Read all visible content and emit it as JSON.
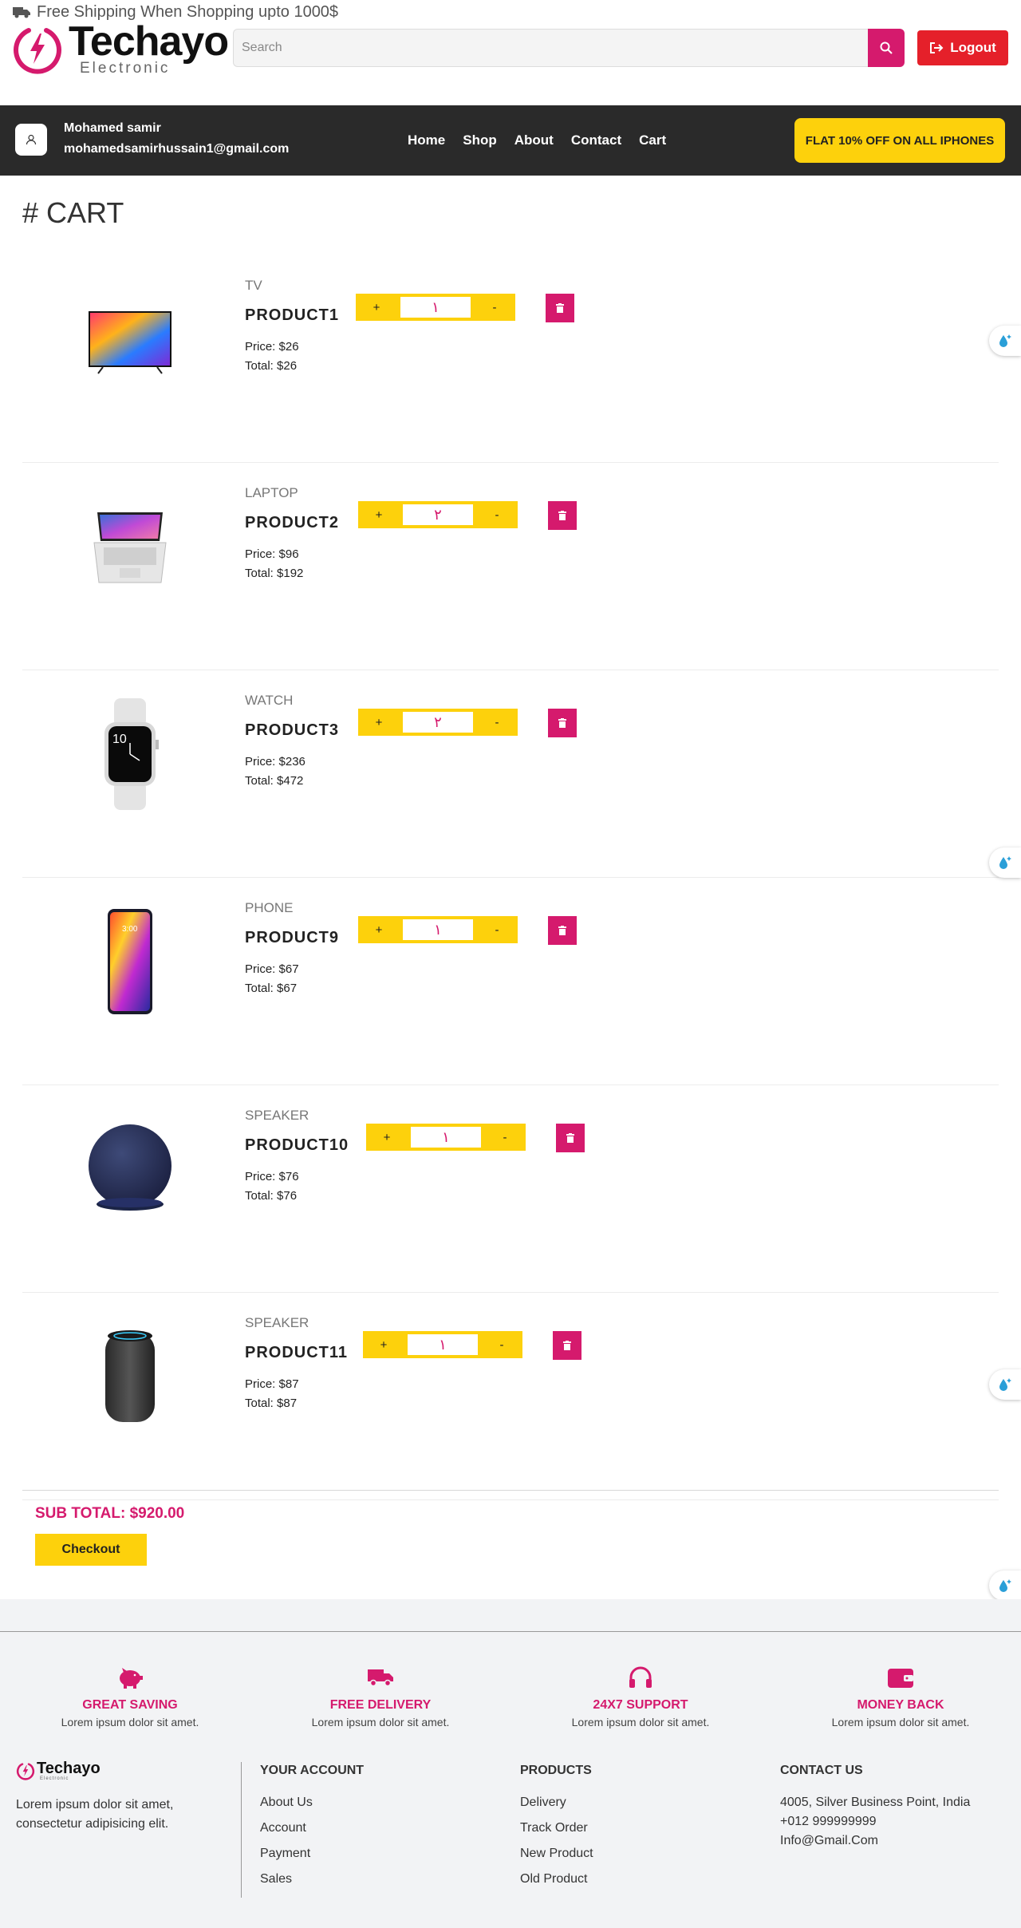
{
  "header": {
    "shipping_text": "Free Shipping When Shopping upto 1000$",
    "logo_name": "Techayo",
    "logo_sub": "Electronic",
    "search_placeholder": "Search",
    "logout_label": "Logout"
  },
  "navbar": {
    "user_name": "Mohamed samir",
    "user_email": "mohamedsamirhussain1@gmail.com",
    "links": [
      "Home",
      "Shop",
      "About",
      "Contact",
      "Cart"
    ],
    "promo": "FLAT 10% OFF ON ALL IPHONES"
  },
  "cart": {
    "title": "# CART",
    "items": [
      {
        "category": "TV",
        "name": "PRODUCT1",
        "price": "Price: $26",
        "total": "Total: $26",
        "qty": "١",
        "plus": "+",
        "minus": "-",
        "image": "tv"
      },
      {
        "category": "LAPTOP",
        "name": "PRODUCT2",
        "price": "Price: $96",
        "total": "Total: $192",
        "qty": "٢",
        "plus": "+",
        "minus": "-",
        "image": "laptop"
      },
      {
        "category": "WATCH",
        "name": "PRODUCT3",
        "price": "Price: $236",
        "total": "Total: $472",
        "qty": "٢",
        "plus": "+",
        "minus": "-",
        "image": "watch"
      },
      {
        "category": "PHONE",
        "name": "PRODUCT9",
        "price": "Price: $67",
        "total": "Total: $67",
        "qty": "١",
        "plus": "+",
        "minus": "-",
        "image": "phone"
      },
      {
        "category": "SPEAKER",
        "name": "PRODUCT10",
        "price": "Price: $76",
        "total": "Total: $76",
        "qty": "١",
        "plus": "+",
        "minus": "-",
        "image": "speaker-round"
      },
      {
        "category": "SPEAKER",
        "name": "PRODUCT11",
        "price": "Price: $87",
        "total": "Total: $87",
        "qty": "١",
        "plus": "+",
        "minus": "-",
        "image": "speaker-cylinder"
      }
    ],
    "subtotal": "SUB TOTAL: $920.00",
    "checkout_label": "Checkout"
  },
  "footer": {
    "features": [
      {
        "icon": "piggy-bank-icon",
        "title": "GREAT SAVING",
        "desc": "Lorem ipsum dolor sit amet."
      },
      {
        "icon": "truck-icon",
        "title": "FREE DELIVERY",
        "desc": "Lorem ipsum dolor sit amet."
      },
      {
        "icon": "headphones-icon",
        "title": "24X7 SUPPORT",
        "desc": "Lorem ipsum dolor sit amet."
      },
      {
        "icon": "wallet-icon",
        "title": "MONEY BACK",
        "desc": "Lorem ipsum dolor sit amet."
      }
    ],
    "logo_name": "Techayo",
    "logo_sub": "Electronic",
    "about": "Lorem ipsum dolor sit amet, consectetur adipisicing elit.",
    "account": {
      "title": "YOUR ACCOUNT",
      "links": [
        "About Us",
        "Account",
        "Payment",
        "Sales"
      ]
    },
    "products": {
      "title": "PRODUCTS",
      "links": [
        "Delivery",
        "Track Order",
        "New Product",
        "Old Product"
      ]
    },
    "contact": {
      "title": "CONTACT US",
      "lines": [
        "4005, Silver Business Point, India",
        "+012 999999999",
        "Info@Gmail.Com"
      ]
    }
  },
  "colors": {
    "brand": "#d51a6d",
    "accent_yellow": "#fdd10c",
    "logout_red": "#e5202a",
    "navbar": "#2a2a2a"
  }
}
